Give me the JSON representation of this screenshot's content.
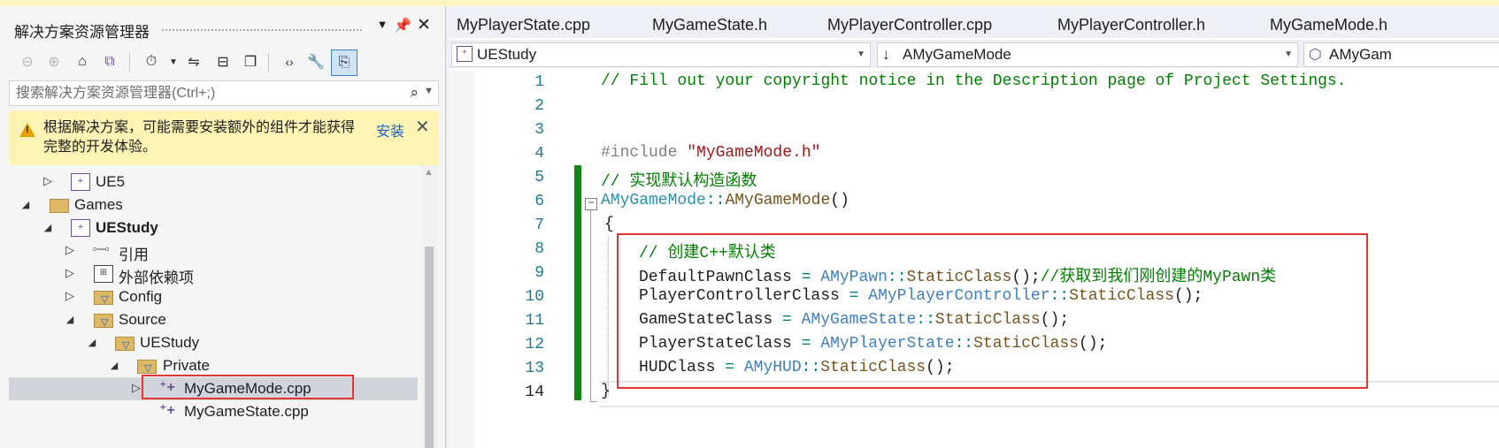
{
  "solution_explorer": {
    "title": "解决方案资源管理器",
    "pin_icon": "pin-icon",
    "search_placeholder": "搜索解决方案资源管理器(Ctrl+;)",
    "info_bar": {
      "message": "根据解决方案，可能需要安装额外的组件才能获得完整的开发体验。",
      "install_label": "安装"
    },
    "tree": [
      {
        "label": "UE5",
        "icon": "project-icon",
        "expander": "▷"
      },
      {
        "label": "Games",
        "icon": "folder-icon",
        "expander": "◢"
      },
      {
        "label": "UEStudy",
        "icon": "project-icon",
        "expander": "◢"
      },
      {
        "label": "引用",
        "icon": "references-icon",
        "expander": "▷"
      },
      {
        "label": "外部依赖项",
        "icon": "external-deps-icon",
        "expander": "▷"
      },
      {
        "label": "Config",
        "icon": "filter-icon",
        "expander": "▷"
      },
      {
        "label": "Source",
        "icon": "filter-icon",
        "expander": "◢"
      },
      {
        "label": "UEStudy",
        "icon": "filter-icon",
        "expander": "◢"
      },
      {
        "label": "Private",
        "icon": "filter-icon",
        "expander": "◢"
      },
      {
        "label": "MyGameMode.cpp",
        "icon": "cpp-file-icon",
        "expander": "▷"
      },
      {
        "label": "MyGameState.cpp",
        "icon": "cpp-file-icon",
        "expander": ""
      }
    ]
  },
  "editor": {
    "tabs": [
      "MyPlayerState.cpp",
      "MyGameState.h",
      "MyPlayerController.cpp",
      "MyPlayerController.h",
      "MyGameMode.h"
    ],
    "nav": {
      "project": "UEStudy",
      "scope": "AMyGameMode",
      "member": "AMyGam"
    },
    "line_numbers": [
      "1",
      "2",
      "3",
      "4",
      "5",
      "6",
      "7",
      "8",
      "9",
      "10",
      "11",
      "12",
      "13",
      "14"
    ],
    "code": {
      "l1": "// Fill out your copyright notice in the Description page of Project Settings.",
      "l4a": "#include ",
      "l4b": "\"MyGameMode.h\"",
      "l5": "// 实现默认构造函数",
      "l6a": "AMyGameMode",
      "l6b": "::",
      "l6c": "AMyGameMode",
      "l6d": "()",
      "l7": "{",
      "l8": "// 创建C++默认类",
      "l9a": "DefaultPawnClass ",
      "l9b": "=",
      "l9c": "AMyPawn",
      "l9d": "::",
      "l9e": "StaticClass",
      "l9f": "();",
      "l9g": "//获取到我们刚创建的MyPawn类",
      "l10a": "PlayerControllerClass ",
      "l10b": "=",
      "l10c": "AMyPlayerController",
      "l10d": "::",
      "l10e": "StaticClass",
      "l10f": "();",
      "l11a": "GameStateClass ",
      "l11b": "=",
      "l11c": "AMyGameState",
      "l11d": "::",
      "l11e": "StaticClass",
      "l11f": "();",
      "l12a": "PlayerStateClass ",
      "l12b": "=",
      "l12c": "AMyPlayerState",
      "l12d": "::",
      "l12e": "StaticClass",
      "l12f": "();",
      "l13a": "HUDClass ",
      "l13b": "=",
      "l13c": "AMyHUD",
      "l13d": "::",
      "l13e": "StaticClass",
      "l13f": "();",
      "l14": "}"
    }
  },
  "colors": {
    "comment": "#008000",
    "type": "#2b91af",
    "string": "#a31515",
    "highlight_box": "#e33535",
    "change_bar": "#108810"
  }
}
